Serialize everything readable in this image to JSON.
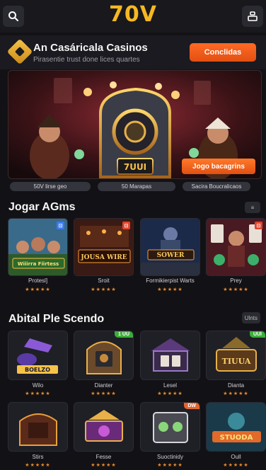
{
  "header": {
    "logo_text": "70V",
    "search_icon": "search-icon",
    "profile_icon": "profile-icon"
  },
  "promo": {
    "title": "An Casáricala  Casinos",
    "subtitle": "Pirasentie trust done lices quartes",
    "button_label": "Conclidas",
    "icon": "diamond-icon"
  },
  "hero": {
    "slot_sign": "7UUI",
    "cta_label": "Jogo bacagrins"
  },
  "pills": [
    "50V lirse geo",
    "50 Marapas",
    "Sacira Boucralicaos"
  ],
  "section1": {
    "title": "Jogar AGms",
    "more_label": "≡",
    "games": [
      {
        "title": "Wiiirra Fiirtess",
        "name": "Protesl]",
        "stars": "★★★★★",
        "badge": "⊡",
        "badge_color": "#3a7bf2"
      },
      {
        "title": "JOUSA WIRE",
        "name": "Sroit",
        "stars": "★★★★★",
        "badge": "⊡",
        "badge_color": "#e2452e"
      },
      {
        "title": "SOWER",
        "name": "Formikierpist Warts",
        "stars": "★★★★★",
        "badge": "",
        "badge_color": ""
      },
      {
        "title": "",
        "name": "Prey",
        "stars": "★★★★★",
        "badge": "⊡",
        "badge_color": "#e2452e"
      }
    ]
  },
  "section2": {
    "title": "Abital Ple Scendo",
    "more_label": "Ulnts",
    "games": [
      {
        "title": "BOELZO",
        "name": "Wilo",
        "stars": "★★★★★",
        "badge": "",
        "badge_color": ""
      },
      {
        "title": "",
        "name": "Dianter",
        "stars": "★★★★★",
        "badge": "1 UU",
        "badge_color": "#3cae3a"
      },
      {
        "title": "",
        "name": "Lesel",
        "stars": "★★★★★",
        "badge": "",
        "badge_color": ""
      },
      {
        "title": "TIUUA",
        "name": "Dianta",
        "stars": "★★★★★",
        "badge": "UUI",
        "badge_color": "#3cae3a"
      }
    ],
    "games_row2": [
      {
        "title": "",
        "name": "Stirs",
        "stars": "★★★★★",
        "badge": "",
        "badge_color": ""
      },
      {
        "title": "",
        "name": "Fesse",
        "stars": "★★★★★",
        "badge": "",
        "badge_color": ""
      },
      {
        "title": "",
        "name": "Suoctinidy",
        "stars": "★★★★★",
        "badge": "DW",
        "badge_color": "#e2652e"
      },
      {
        "title": "STUODA",
        "name": "Oull",
        "stars": "★★★★★",
        "badge": "",
        "badge_color": ""
      }
    ]
  },
  "colors": {
    "accent": "#f6b821",
    "cta": "#ff6a24",
    "background": "#121216"
  }
}
